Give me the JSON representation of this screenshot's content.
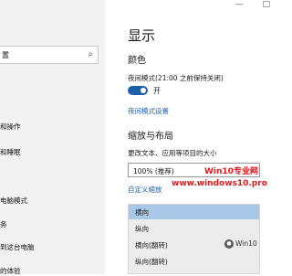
{
  "window": {
    "minimize_glyph": "—",
    "maximize_glyph": "□"
  },
  "sidebar": {
    "search_text": "置",
    "items": [
      "和操作",
      "和睡眠",
      "电脑模式",
      "务",
      "到这台电脑",
      "的体验"
    ]
  },
  "main": {
    "title": "显示",
    "color_heading": "颜色",
    "night_mode_label": "夜间模式(21:00 之前保持关闭)",
    "toggle_state": "开",
    "toggle_on": true,
    "night_mode_settings_link": "夜间模式设置",
    "scale_heading": "缩放与布局",
    "scale_label": "更改文本、应用等项目的大小",
    "scale_value": "100% (推荐)",
    "custom_scale_link": "自定义缩放",
    "orientation_options": [
      "横向",
      "纵向",
      "横向(翻转)",
      "纵向(翻转)"
    ],
    "orientation_selected_index": 0
  },
  "watermark": {
    "line1": "Win10专业网",
    "line2": "www.windows10.pro",
    "wechat": "Win10"
  },
  "colors": {
    "accent": "#1e5fa8",
    "link": "#1d5fa7",
    "watermark": "#e8151b",
    "selected_option": "#a9c8e8"
  }
}
